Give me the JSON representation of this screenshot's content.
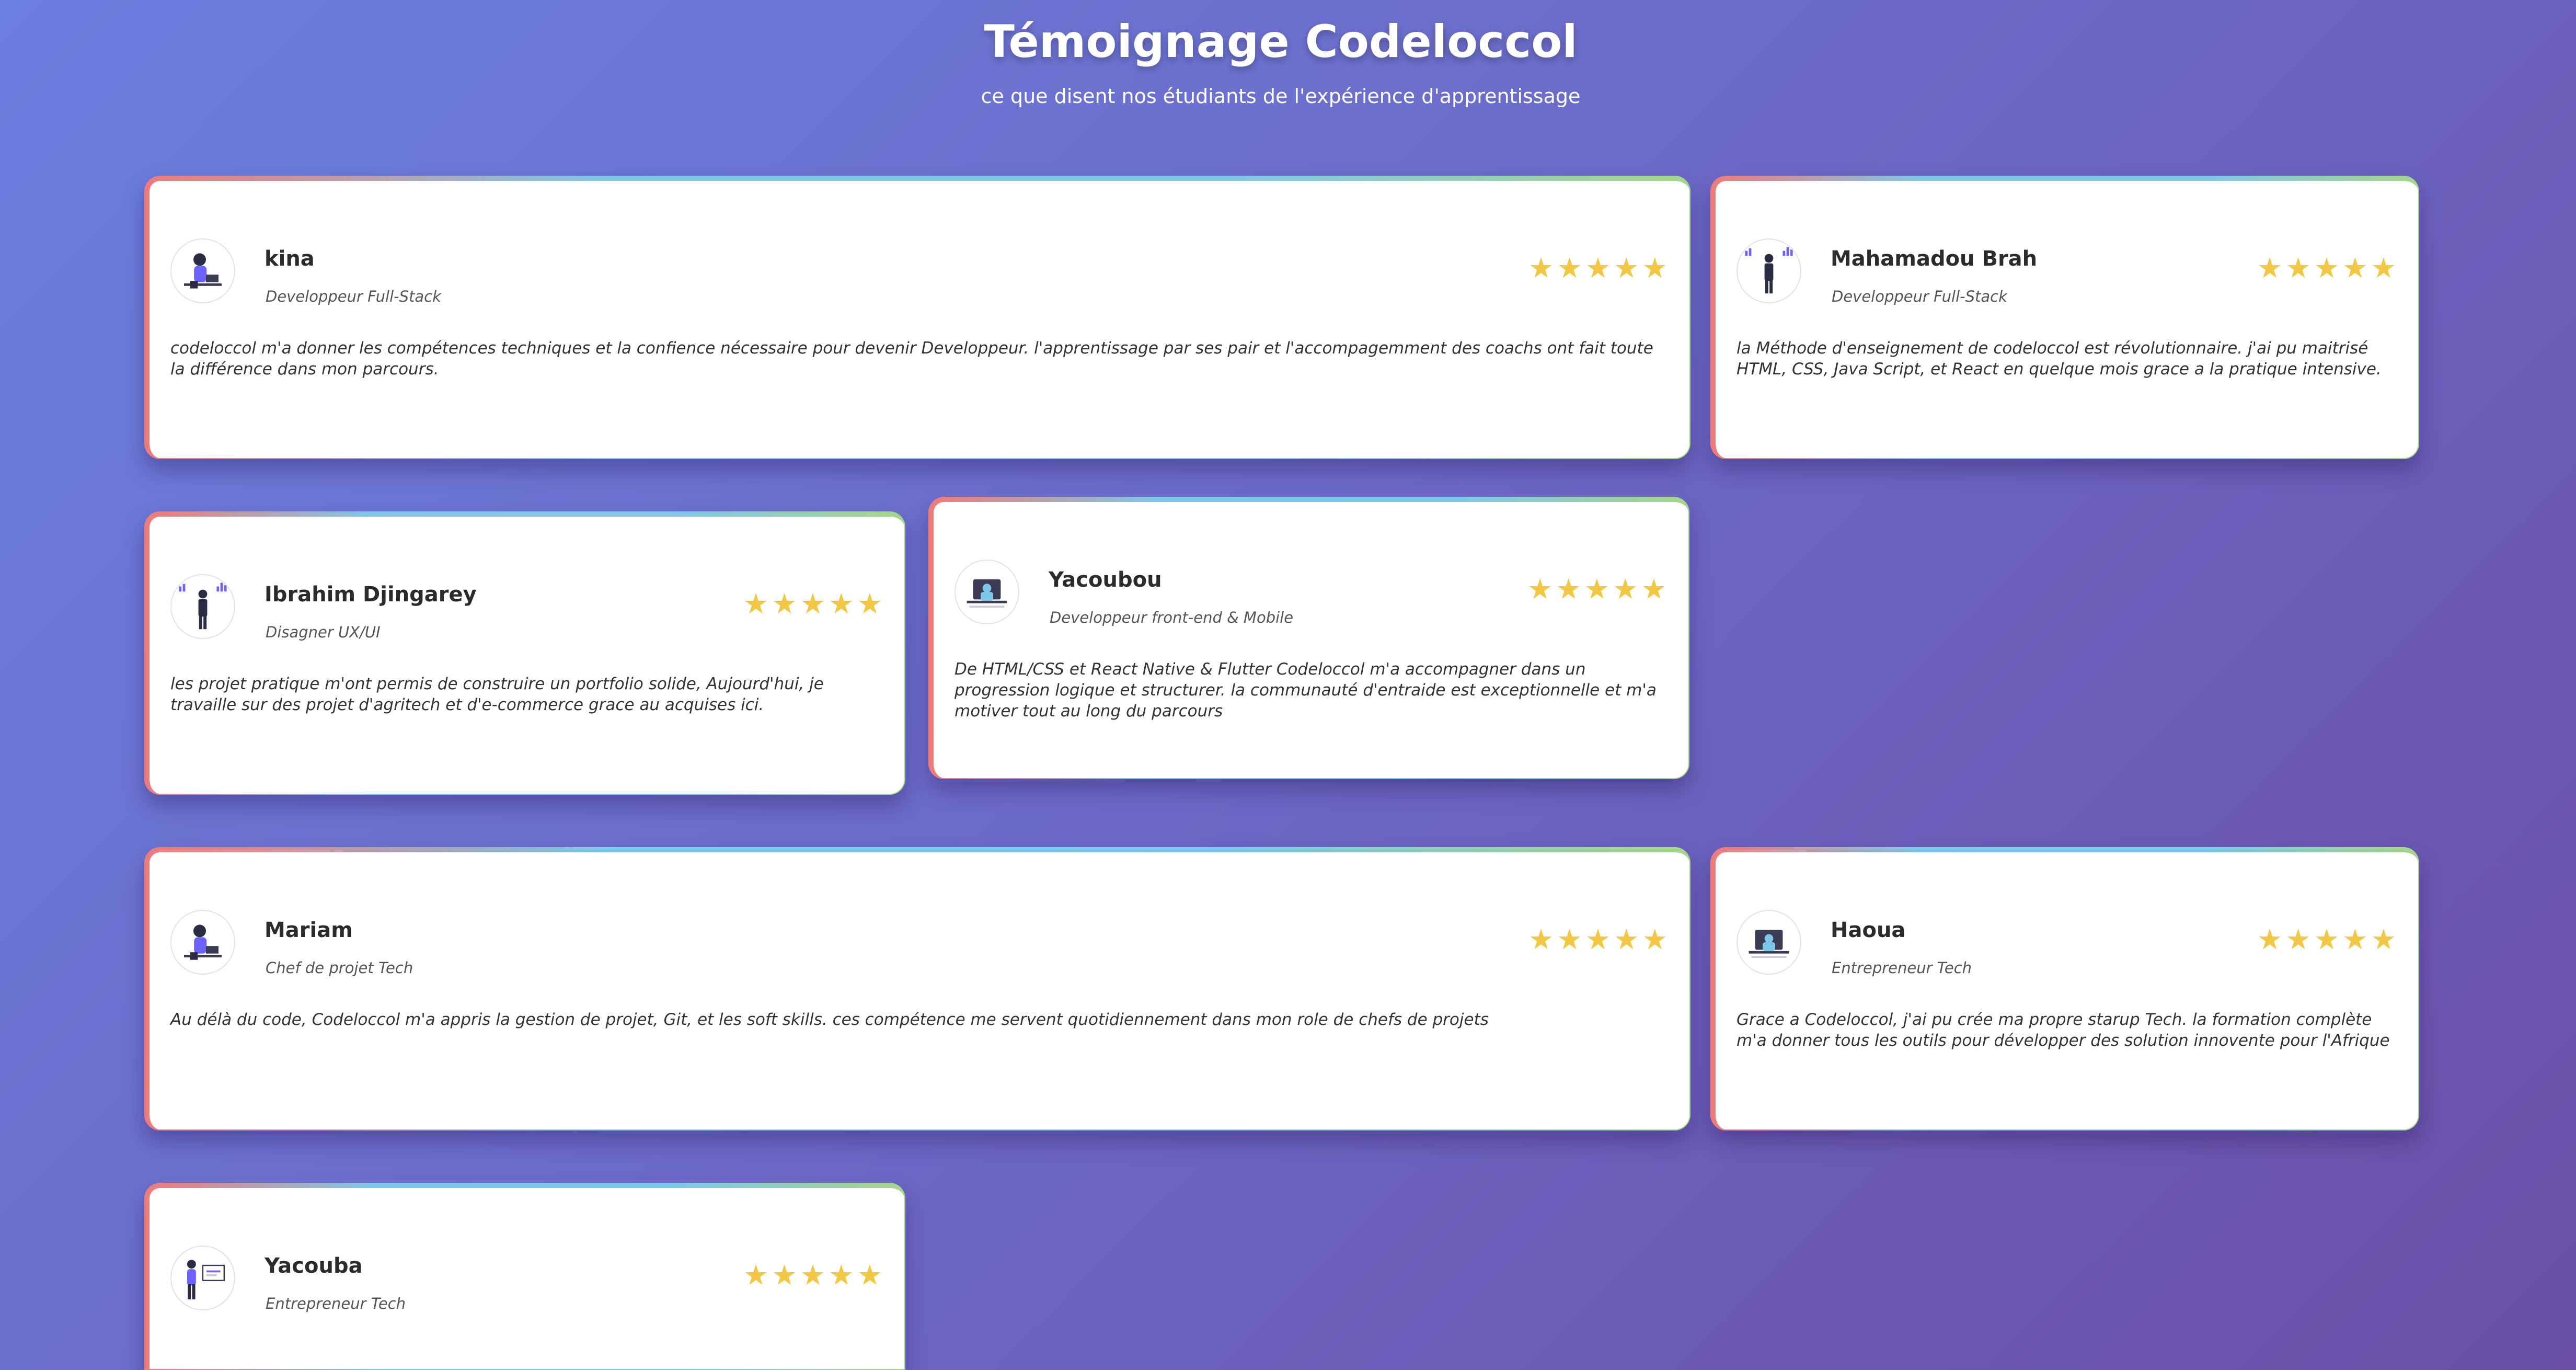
{
  "header": {
    "title": "Témoignage Codeloccol",
    "subtitle": "ce que disent nos étudiants de l'expérience d'apprentissage"
  },
  "colors": {
    "background_start": "#6b7fe0",
    "background_end": "#6b4fa8",
    "star": "#f2c744",
    "card_border_gradient": [
      "#ef7a7a",
      "#7ec7e8",
      "#a6d68a"
    ]
  },
  "testimonials": [
    {
      "name": "kina",
      "role": "Developpeur Full-Stack",
      "rating": 5,
      "avatar_icon": "developer-at-laptop-illustration",
      "text": "codeloccol m'a donner les compétences techniques et la confience nécessaire pour devenir Developpeur. l'apprentissage par ses pair et l'accompagemment des coachs ont fait toute la différence dans mon parcours."
    },
    {
      "name": "Mahamadou Brah",
      "role": "Developpeur Full-Stack",
      "rating": 5,
      "avatar_icon": "businessman-chart-illustration",
      "text": "la Méthode d'enseignement de codeloccol est révolutionnaire. j'ai pu maitrisé HTML, CSS, Java Script, et React en quelque mois grace a la pratique intensive."
    },
    {
      "name": "Ibrahim Djingarey",
      "role": "Disagner UX/UI",
      "rating": 5,
      "avatar_icon": "businessman-chart-illustration",
      "text": "les projet pratique m'ont permis de construire un portfolio solide, Aujourd'hui, je travaille sur des projet d'agritech et d'e-commerce grace au acquises ici."
    },
    {
      "name": "Yacoubou",
      "role": "Developpeur front-end & Mobile",
      "rating": 5,
      "avatar_icon": "person-at-desk-illustration",
      "text": "De HTML/CSS et React Native & Flutter Codeloccol m'a accompagner dans un progression logique et structurer. la communauté d'entraide est exceptionnelle et m'a motiver tout au long du parcours"
    },
    {
      "name": "Mariam",
      "role": "Chef de projet Tech",
      "rating": 5,
      "avatar_icon": "developer-at-laptop-illustration",
      "text": "Au délà du code, Codeloccol m'a appris la gestion de projet, Git, et les soft skills. ces compétence me servent quotidiennement dans mon role de chefs de projets"
    },
    {
      "name": "Haoua",
      "role": "Entrepreneur Tech",
      "rating": 5,
      "avatar_icon": "person-at-desk-illustration",
      "text": "Grace a Codeloccol, j'ai pu crée ma propre starup Tech. la formation complète m'a donner tous les outils pour développer des solution innovente pour l'Afrique"
    },
    {
      "name": "Yacouba",
      "role": "Entrepreneur Tech",
      "rating": 5,
      "avatar_icon": "presenter-board-illustration",
      "text": ""
    }
  ]
}
